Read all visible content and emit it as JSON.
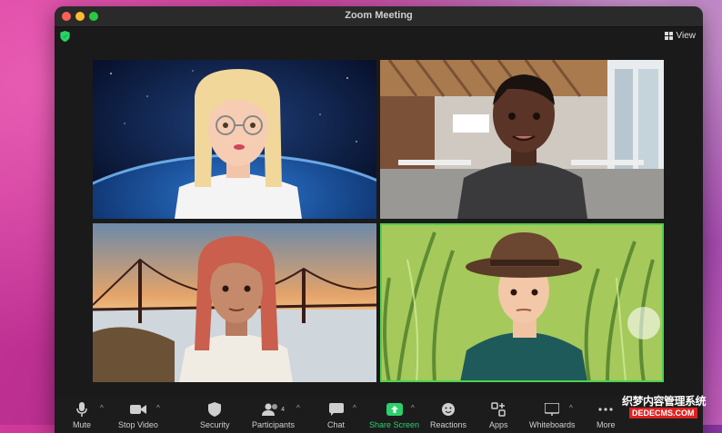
{
  "window": {
    "title": "Zoom Meeting"
  },
  "view_button": {
    "label": "View"
  },
  "toolbar": {
    "mute": "Mute",
    "stop_video": "Stop Video",
    "security": "Security",
    "participants": "Participants",
    "participants_count": "4",
    "chat": "Chat",
    "share_screen": "Share Screen",
    "reactions": "Reactions",
    "apps": "Apps",
    "whiteboards": "Whiteboards",
    "more": "More"
  },
  "watermark": {
    "line1": "织梦内容管理系统",
    "line2": "DEDECMS.COM"
  },
  "colors": {
    "active_speaker": "#4fd14f",
    "share_accent": "#2bd06a"
  }
}
